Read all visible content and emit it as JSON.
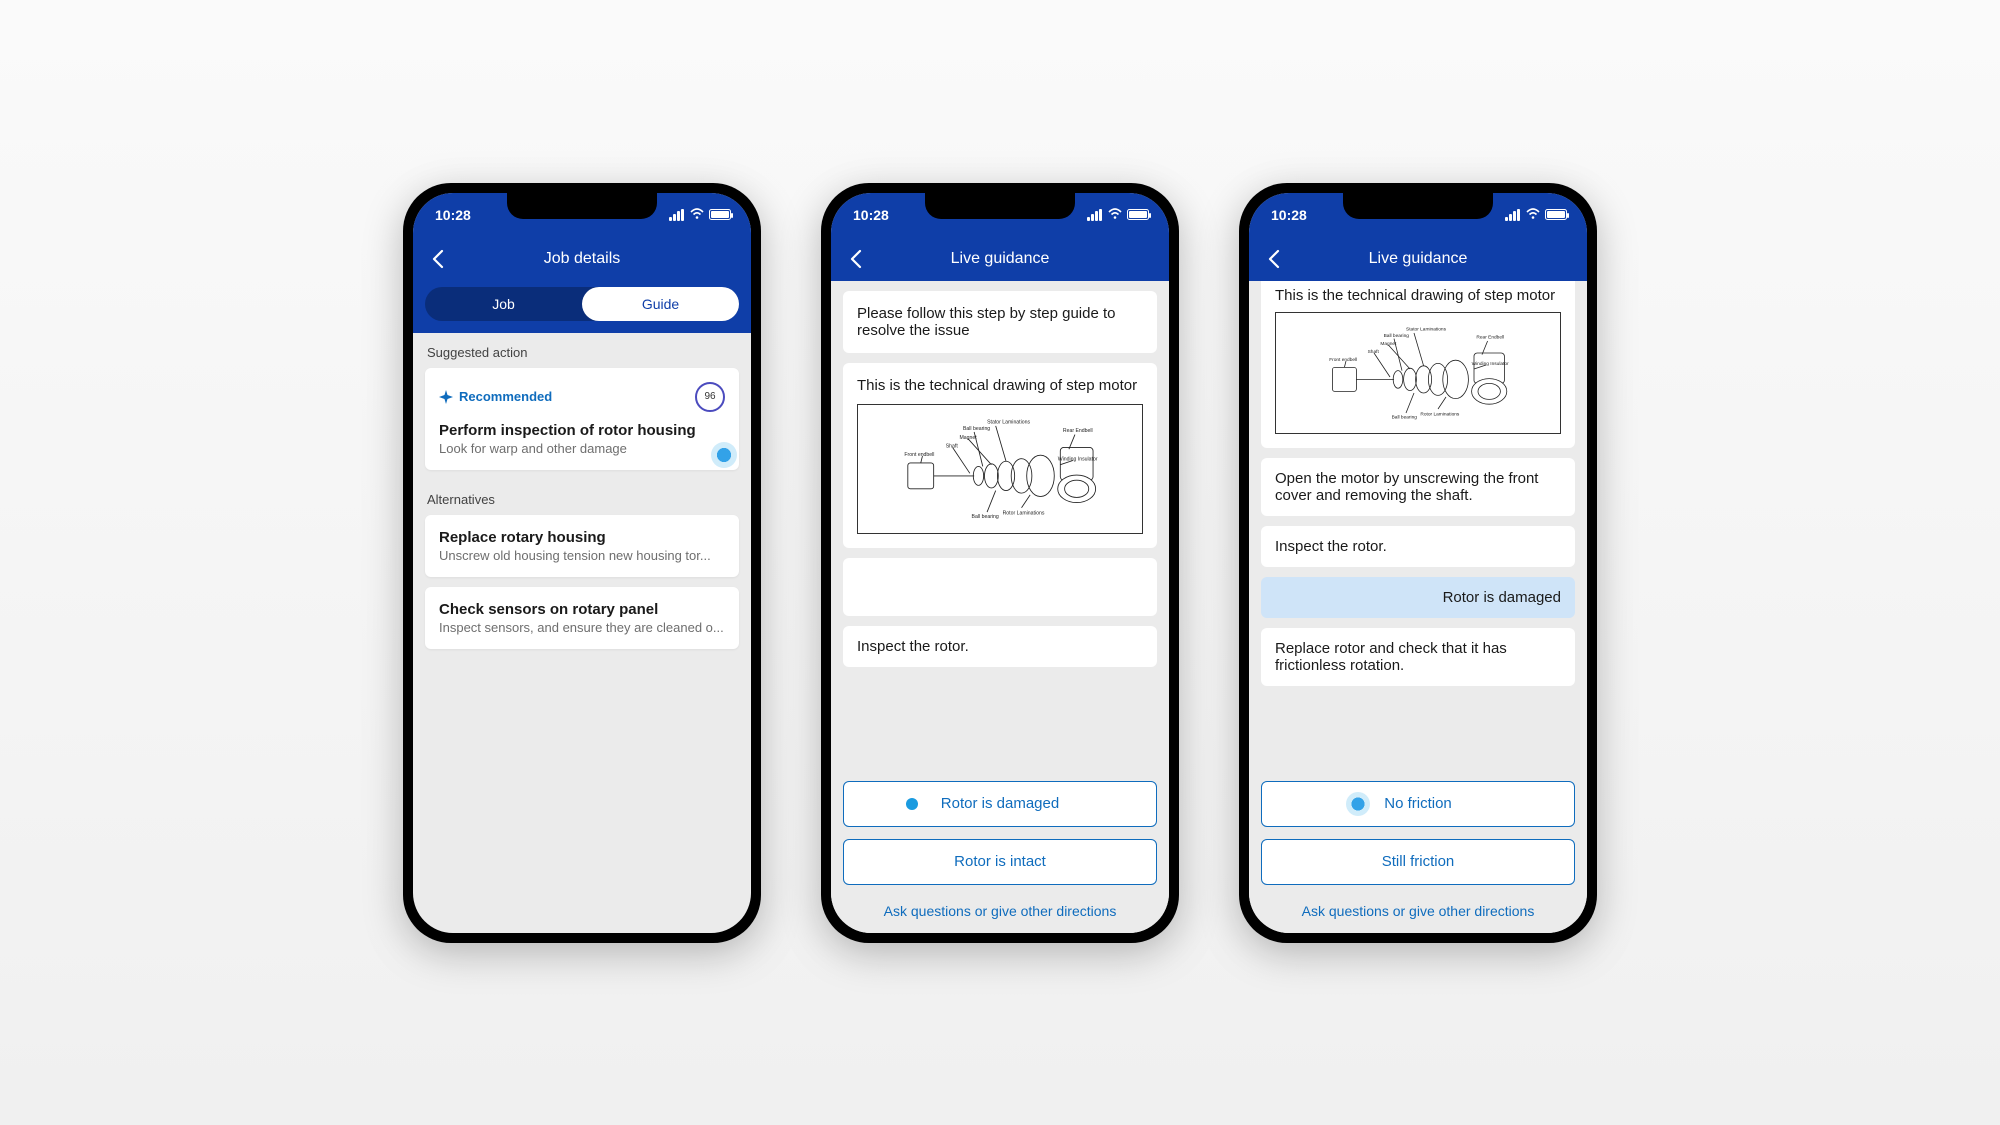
{
  "status": {
    "time": "10:28"
  },
  "screen1": {
    "title": "Job details",
    "tabs": {
      "job": "Job",
      "guide": "Guide"
    },
    "suggested_label": "Suggested action",
    "recommended_label": "Recommended",
    "score": "96",
    "rec_title": "Perform inspection of rotor housing",
    "rec_sub": "Look for warp and other damage",
    "alt_label": "Alternatives",
    "alt1_title": "Replace rotary housing",
    "alt1_sub": "Unscrew old housing tension new housing tor...",
    "alt2_title": "Check sensors on rotary panel",
    "alt2_sub": "Inspect sensors, and ensure they are cleaned o..."
  },
  "screen2": {
    "title": "Live guidance",
    "msg_intro": "Please follow this step by step guide to resolve the issue",
    "msg_drawing": "This is the technical drawing of step motor",
    "msg_inspect": "Inspect the rotor.",
    "opt_damaged": "Rotor is damaged",
    "opt_intact": "Rotor is intact",
    "ask": "Ask questions or give other directions"
  },
  "screen3": {
    "title": "Live guidance",
    "msg_drawing": "This is the technical drawing of step motor",
    "msg_open": "Open the motor by unscrewing the front cover and removing the shaft.",
    "msg_inspect": "Inspect the rotor.",
    "reply_damaged": "Rotor is damaged",
    "msg_replace": "Replace rotor and check that it has frictionless rotation.",
    "opt_no_friction": "No friction",
    "opt_still_friction": "Still friction",
    "ask": "Ask questions or give other directions"
  },
  "diagram_labels": {
    "stator": "Stator Laminations",
    "ball": "Ball bearing",
    "magnet": "Magnet",
    "shaft": "Shaft",
    "front": "Front endbell",
    "rear": "Rear Endbell",
    "winding": "Winding Insulator",
    "rotor": "Rotor Laminations"
  }
}
